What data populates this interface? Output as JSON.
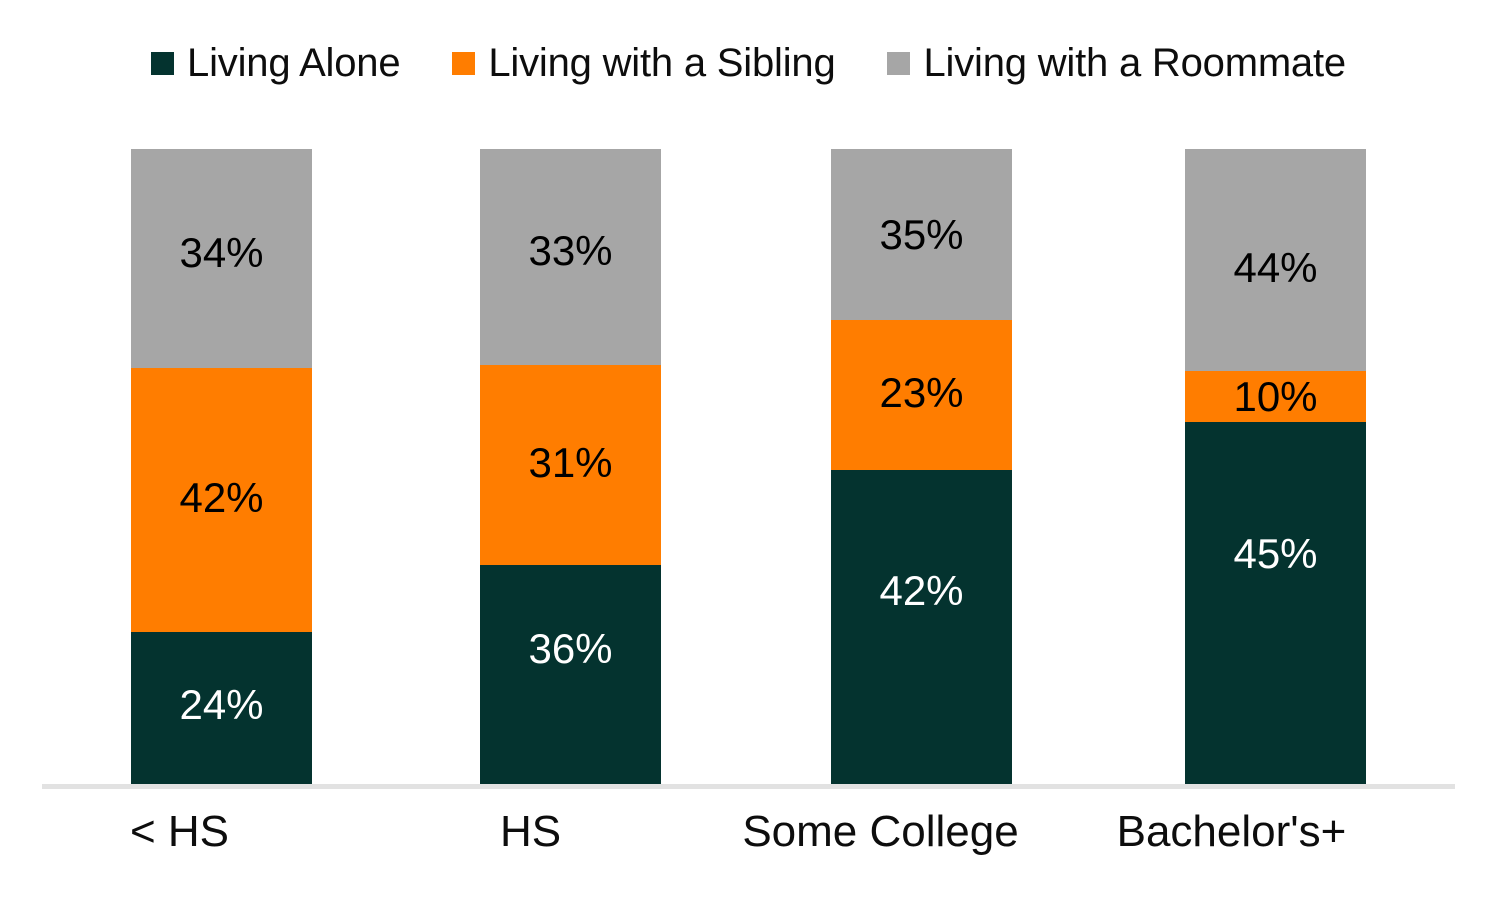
{
  "legend": {
    "position": "top-center",
    "items": [
      {
        "label": "Living Alone",
        "color": "#04332F",
        "icon": "square-swatch-icon"
      },
      {
        "label": "Living with a Sibling",
        "color": "#FF7D00",
        "icon": "square-swatch-icon"
      },
      {
        "label": "Living with a Roommate",
        "color": "#A6A6A6",
        "icon": "square-swatch-icon"
      }
    ]
  },
  "axis": {
    "baseline_color": "#E2E2E2",
    "categories": [
      "< HS",
      "HS",
      "Some College",
      "Bachelor's+"
    ]
  },
  "bars": [
    {
      "category": "< HS",
      "segments": [
        {
          "series": "Living with a Roommate",
          "label": "34%",
          "value": 34
        },
        {
          "series": "Living with a Sibling",
          "label": "42%",
          "value": 42
        },
        {
          "series": "Living Alone",
          "label": "24%",
          "value": 24
        }
      ]
    },
    {
      "category": "HS",
      "segments": [
        {
          "series": "Living with a Roommate",
          "label": "33%",
          "value": 33
        },
        {
          "series": "Living with a Sibling",
          "label": "31%",
          "value": 31
        },
        {
          "series": "Living Alone",
          "label": "36%",
          "value": 36
        }
      ]
    },
    {
      "category": "Some College",
      "segments": [
        {
          "series": "Living with a Roommate",
          "label": "35%",
          "value": 35
        },
        {
          "series": "Living with a Sibling",
          "label": "23%",
          "value": 23
        },
        {
          "series": "Living Alone",
          "label": "42%",
          "value": 42
        }
      ]
    },
    {
      "category": "Bachelor's+",
      "segments": [
        {
          "series": "Living with a Roommate",
          "label": "44%",
          "value": 44
        },
        {
          "series": "Living with a Sibling",
          "label": "10%",
          "value": 10
        },
        {
          "series": "Living Alone",
          "label": "45%",
          "value": 45
        }
      ]
    }
  ],
  "chart_data": {
    "type": "bar",
    "subtype": "stacked-100-percent",
    "orientation": "vertical",
    "title": "",
    "subtitle": "",
    "xlabel": "",
    "ylabel": "",
    "ylim": [
      0,
      100
    ],
    "grid": false,
    "legend_position": "top-center",
    "value_suffix": "%",
    "categories": [
      "< HS",
      "HS",
      "Some College",
      "Bachelor's+"
    ],
    "series": [
      {
        "name": "Living Alone",
        "color": "#04332F",
        "values": [
          24,
          36,
          42,
          45
        ],
        "labels": [
          "24%",
          "36%",
          "42%",
          "45%"
        ]
      },
      {
        "name": "Living with a Sibling",
        "color": "#FF7D00",
        "values": [
          42,
          31,
          23,
          10
        ],
        "labels": [
          "42%",
          "31%",
          "23%",
          "10%"
        ]
      },
      {
        "name": "Living with a Roommate",
        "color": "#A6A6A6",
        "values": [
          34,
          33,
          35,
          44
        ],
        "labels": [
          "34%",
          "33%",
          "35%",
          "44%"
        ]
      }
    ],
    "stack_order_top_to_bottom": [
      "Living with a Roommate",
      "Living with a Sibling",
      "Living Alone"
    ],
    "column_totals": [
      100,
      100,
      100,
      99
    ]
  }
}
